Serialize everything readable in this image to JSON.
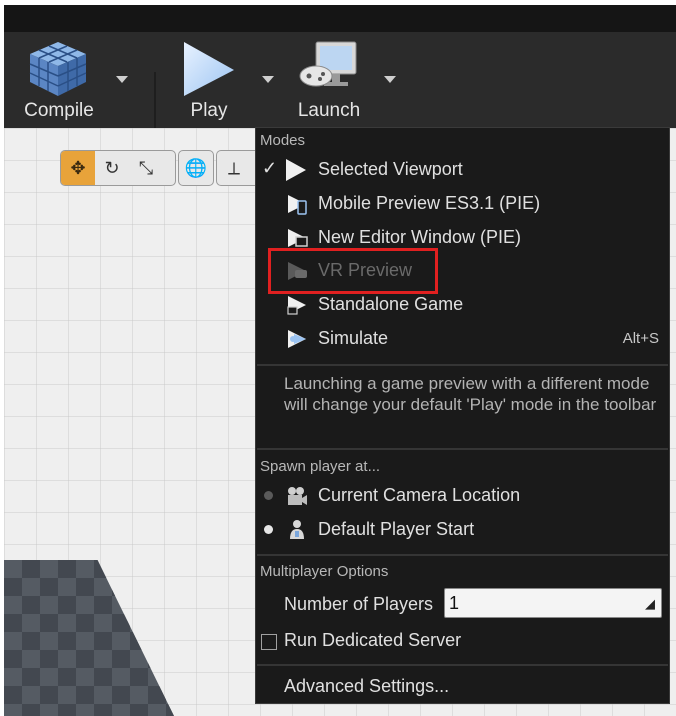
{
  "toolbar": {
    "compile_label": "Compile",
    "play_label": "Play",
    "launch_label": "Launch"
  },
  "menu": {
    "modes_header": "Modes",
    "modes": [
      {
        "label": "Selected Viewport",
        "checked": true,
        "icon": "play-icon"
      },
      {
        "label": "Mobile Preview ES3.1 (PIE)",
        "checked": false,
        "icon": "mobile-preview-icon"
      },
      {
        "label": "New Editor Window (PIE)",
        "checked": false,
        "icon": "new-window-icon"
      },
      {
        "label": "VR Preview",
        "checked": false,
        "disabled": true,
        "icon": "vr-preview-icon"
      },
      {
        "label": "Standalone Game",
        "checked": false,
        "icon": "standalone-game-icon"
      },
      {
        "label": "Simulate",
        "checked": false,
        "icon": "simulate-icon",
        "shortcut": "Alt+S"
      }
    ],
    "note": "Launching a game preview with a different mode will change your default 'Play' mode in the toolbar",
    "spawn_header": "Spawn player at...",
    "spawn": [
      {
        "label": "Current Camera Location",
        "selected": false,
        "icon": "camera-icon"
      },
      {
        "label": "Default Player Start",
        "selected": true,
        "icon": "player-start-icon"
      }
    ],
    "multiplayer_header": "Multiplayer Options",
    "num_players_label": "Number of Players",
    "num_players_value": "1",
    "dedicated_server_label": "Run Dedicated Server",
    "advanced_label": "Advanced Settings..."
  },
  "colors": {
    "highlight": "#e02020",
    "active_tool": "#e8a33a"
  }
}
